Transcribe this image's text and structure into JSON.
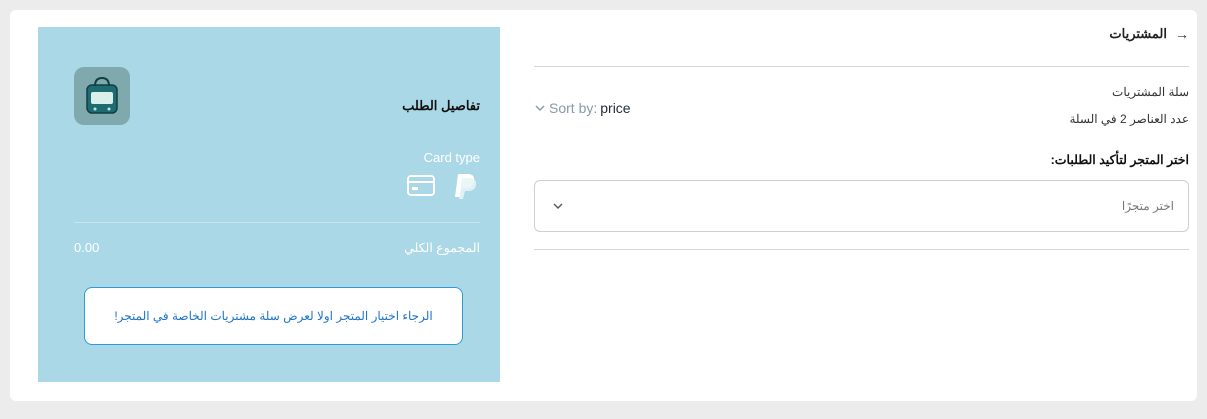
{
  "cart": {
    "header_title": "المشتريات",
    "cart_title": "سلة المشتريات",
    "items_count_text": "عدد العناصر 2 في السلة",
    "sort_prefix": "Sort by:",
    "sort_value": "price",
    "choose_store_label": "اختر المتجر لتأكيد الطلبات:",
    "store_select_placeholder": "اختر متجرًا"
  },
  "order_details": {
    "title": "تفاصيل الطلب",
    "card_type_label": "Card type",
    "payment_icons": [
      "paypal-icon",
      "credit-card-icon"
    ],
    "total_label": "المجموع الكلي",
    "total_value": "0.00",
    "notice": "الرجاء اختيار المتجر اولا لعرض سلة مشتريات الخاصة في المتجر!"
  },
  "colors": {
    "panel_background": "#abd8e6",
    "notice_border": "#2e9bd3",
    "notice_text": "#1f74c8",
    "page_background": "#ececec"
  }
}
